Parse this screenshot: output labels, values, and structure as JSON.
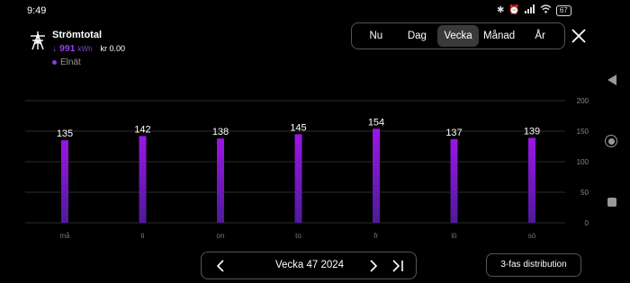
{
  "status_bar": {
    "time": "9:49",
    "battery": "67",
    "icons": [
      "bluetooth-icon",
      "alarm-icon",
      "signal-icon",
      "wifi-icon",
      "battery-icon"
    ]
  },
  "header": {
    "title": "Strömtotal",
    "usage_arrow": "↓",
    "usage_value": "991",
    "usage_unit": "kWh",
    "cost": "kr 0.00",
    "legend_label": "Elnät"
  },
  "period_tabs": [
    "Nu",
    "Dag",
    "Vecka",
    "Månad",
    "År"
  ],
  "active_tab": "Vecka",
  "chart_data": {
    "type": "bar",
    "categories": [
      "må",
      "ti",
      "on",
      "to",
      "fr",
      "lö",
      "sö"
    ],
    "values": [
      135,
      142,
      138,
      145,
      154,
      137,
      139
    ],
    "ylim": [
      0,
      200
    ],
    "yticks": [
      0,
      50,
      100,
      150,
      200
    ],
    "grid": true,
    "bar_color_top": "#9b16e6",
    "bar_color_bottom": "#4e1a99"
  },
  "footer": {
    "week_label": "Vecka 47 2024",
    "distribution_label": "3-fas distribution"
  },
  "colors": {
    "accent": "#9a3ee6",
    "background": "#000000"
  }
}
